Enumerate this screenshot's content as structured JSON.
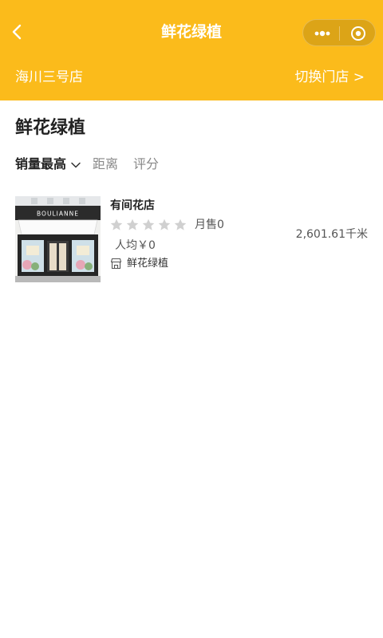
{
  "header": {
    "title": "鲜花绿植",
    "store_name": "海川三号店",
    "switch_label": "切换门店 >"
  },
  "page": {
    "title": "鲜花绿植"
  },
  "sort": {
    "options": [
      "销量最高",
      "距离",
      "评分"
    ],
    "active": "销量最高"
  },
  "stores": [
    {
      "name": "有间花店",
      "rating": 0,
      "rating_max": 5,
      "monthly_sales": "月售0",
      "avg_price": "人均￥0",
      "category": "鲜花绿植",
      "distance": "2,601.61千米",
      "sign_text": "BOULIANNE"
    }
  ],
  "colors": {
    "header_bg": "#fbbb1b",
    "star_inactive": "#d0d0d0"
  }
}
